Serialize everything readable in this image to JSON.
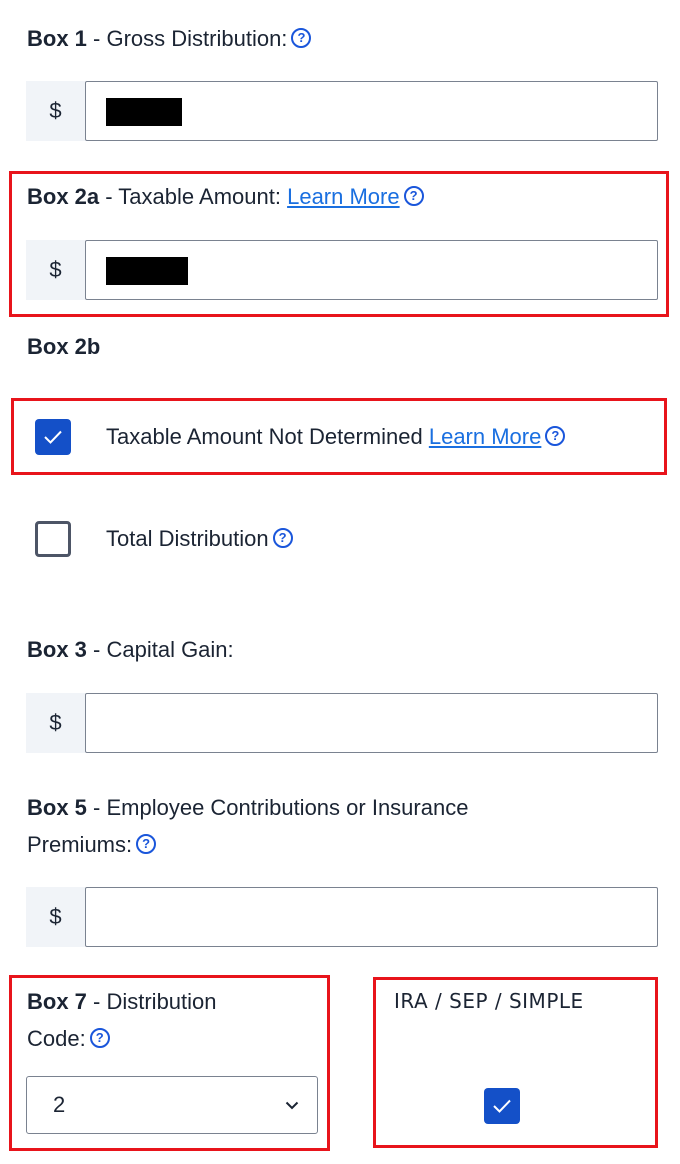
{
  "box1": {
    "label_bold": "Box 1",
    "label_rest": " - Gross Distribution:",
    "prefix": "$",
    "value": "[redacted]"
  },
  "box2a": {
    "label_bold": "Box 2a",
    "label_rest": " - Taxable Amount: ",
    "link": "Learn More",
    "prefix": "$",
    "value": "[redacted]"
  },
  "box2b": {
    "label": "Box 2b",
    "taxable_not_determined": {
      "label": "Taxable Amount Not Determined ",
      "link": "Learn More",
      "checked": true
    },
    "total_distribution": {
      "label": "Total Distribution",
      "checked": false
    }
  },
  "box3": {
    "label_bold": "Box 3",
    "label_rest": " - Capital Gain:",
    "prefix": "$",
    "value": ""
  },
  "box5": {
    "label_bold": "Box 5",
    "label_rest_line1": " - Employee Contributions or Insurance",
    "label_rest_line2": "Premiums:",
    "prefix": "$",
    "value": ""
  },
  "box7": {
    "label_bold": "Box 7",
    "label_rest_line1": " - Distribution",
    "label_rest_line2": "Code:",
    "selected": "2"
  },
  "ira": {
    "label": "IRA / SEP / SIMPLE",
    "checked": true
  },
  "icons": {
    "help": "?",
    "check": "checkmark-icon",
    "chevron": "chevron-down-icon"
  },
  "colors": {
    "accent": "#1450c8",
    "link": "#1a6fe0",
    "highlight": "#e8141b"
  }
}
